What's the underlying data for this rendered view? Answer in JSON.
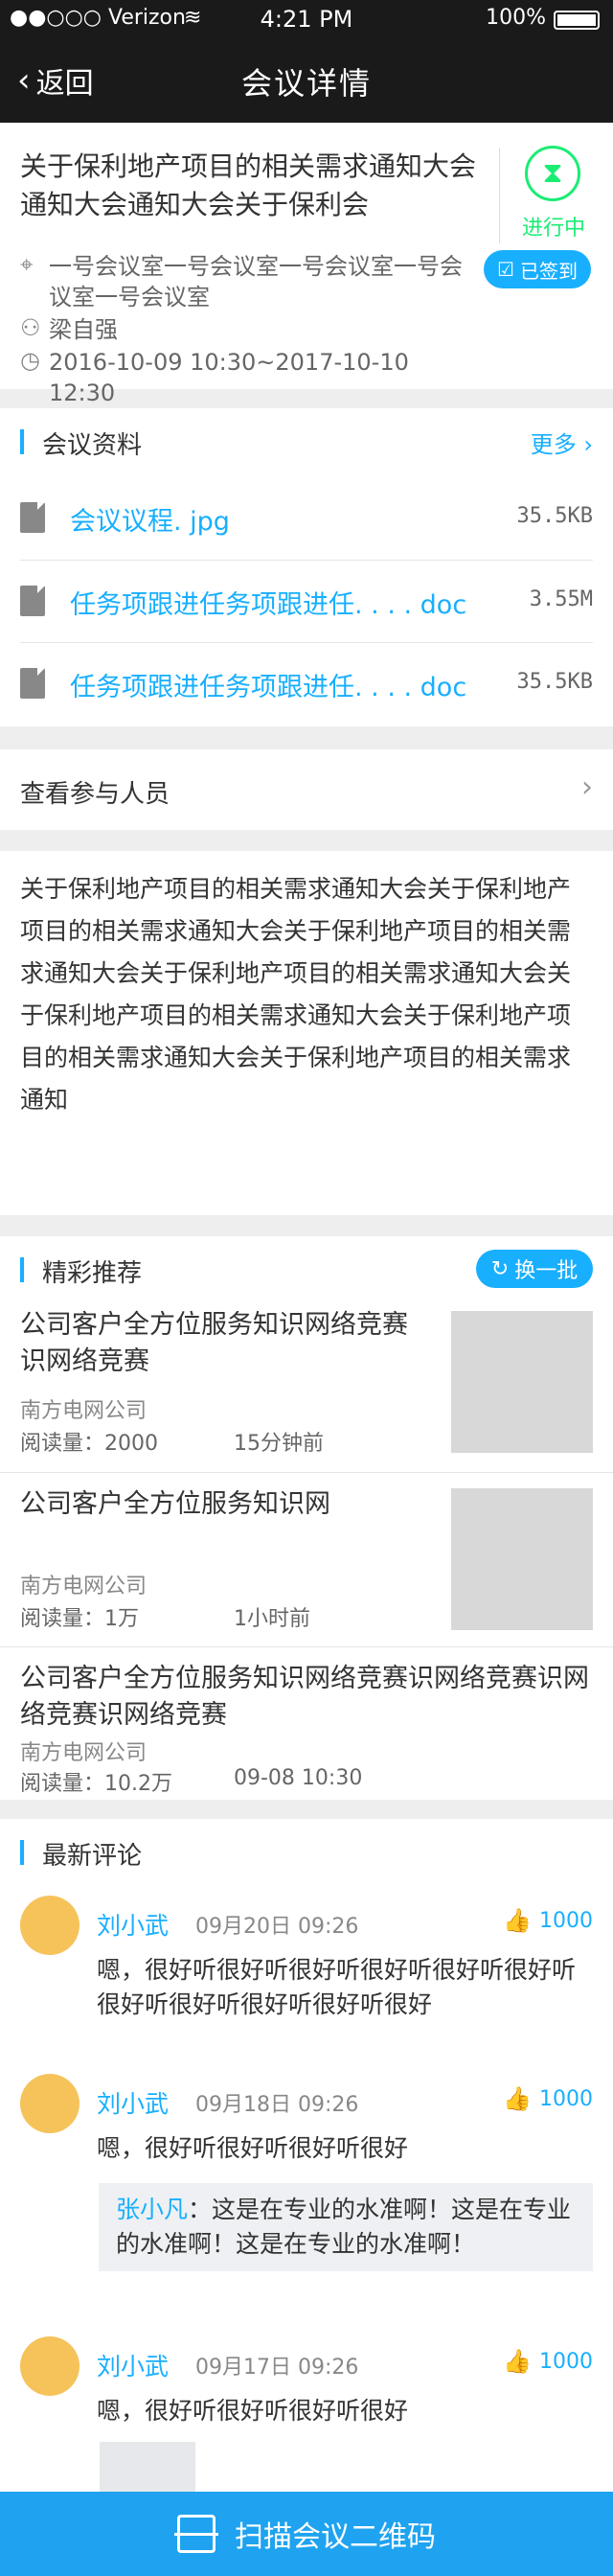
{
  "status_bar": {
    "carrier": "●●○○○ Verizon",
    "wifi": "≋",
    "time": "4:21 PM",
    "battery": "100%"
  },
  "nav": {
    "back_label": "返回",
    "back_icon": "‹",
    "title": "会议详情"
  },
  "meeting": {
    "title": "关于保利地产项目的相关需求通知大会通知大会通知大会关于保利会",
    "status_icon": "⧗",
    "status": "进行中",
    "status_color": "#1AED73",
    "signed_label": "已签到",
    "signed_icon": "☑",
    "location_icon": "⌖",
    "location": "一号会议室一号会议室一号会议室一号会议室一号会议室",
    "person_icon": "⚇",
    "organizer": "梁自强",
    "time_icon": "◷",
    "time_range": "2016-10-09 10:30~2017-10-10 12:30"
  },
  "materials": {
    "title": "会议资料",
    "more_label": "更多 ›",
    "files": [
      {
        "name": "会议议程. jpg",
        "size": "35.5KB"
      },
      {
        "name": "任务项跟进任务项跟进任. . . . doc",
        "size": "3.55M"
      },
      {
        "name": "任务项跟进任务项跟进任. . . . doc",
        "size": "35.5KB"
      }
    ]
  },
  "attendees": {
    "label": "查看参与人员",
    "arrow": "›"
  },
  "description": "关于保利地产项目的相关需求通知大会关于保利地产项目的相关需求通知大会关于保利地产项目的相关需求通知大会关于保利地产项目的相关需求通知大会关于保利地产项目的相关需求通知大会关于保利地产项目的相关需求通知大会关于保利地产项目的相关需求通知",
  "recommend": {
    "title": "精彩推荐",
    "refresh_label": "换一批",
    "refresh_icon": "↻",
    "articles": [
      {
        "title": "公司客户全方位服务知识网络竞赛识网络竞赛",
        "source": "南方电网公司",
        "reads": "阅读量：2000",
        "ago": "15分钟前"
      },
      {
        "title": "公司客户全方位服务知识网",
        "source": "南方电网公司",
        "reads": "阅读量：1万",
        "ago": "1小时前"
      },
      {
        "title": "公司客户全方位服务知识网络竞赛识网络竞赛识网络竞赛识网络竞赛",
        "source": "南方电网公司",
        "reads": "阅读量：10.2万",
        "ago": "09-08 10:30"
      }
    ]
  },
  "comments_section": {
    "title": "最新评论",
    "like_icon": "👍",
    "items": [
      {
        "user": "刘小武",
        "date": "09月20日 09:26",
        "likes": "1000",
        "body": "嗯，很好听很好听很好听很好听很好听很好听很好听很好听很好听很好听很好"
      },
      {
        "user": "刘小武",
        "date": "09月18日 09:26",
        "likes": "1000",
        "body": "嗯，很好听很好听很好听很好",
        "reply_user": "张小凡",
        "reply_text": "：这是在专业的水准啊！这是在专业的水准啊！这是在专业的水准啊！"
      },
      {
        "user": "刘小武",
        "date": "09月17日 09:26",
        "likes": "1000",
        "body": "嗯，很好听很好听很好听很好"
      }
    ]
  },
  "scan": {
    "label": "扫描会议二维码"
  },
  "colors": {
    "accent": "#18AFFE",
    "status_green": "#1AED73",
    "nav_bg": "#1a1a1a"
  }
}
